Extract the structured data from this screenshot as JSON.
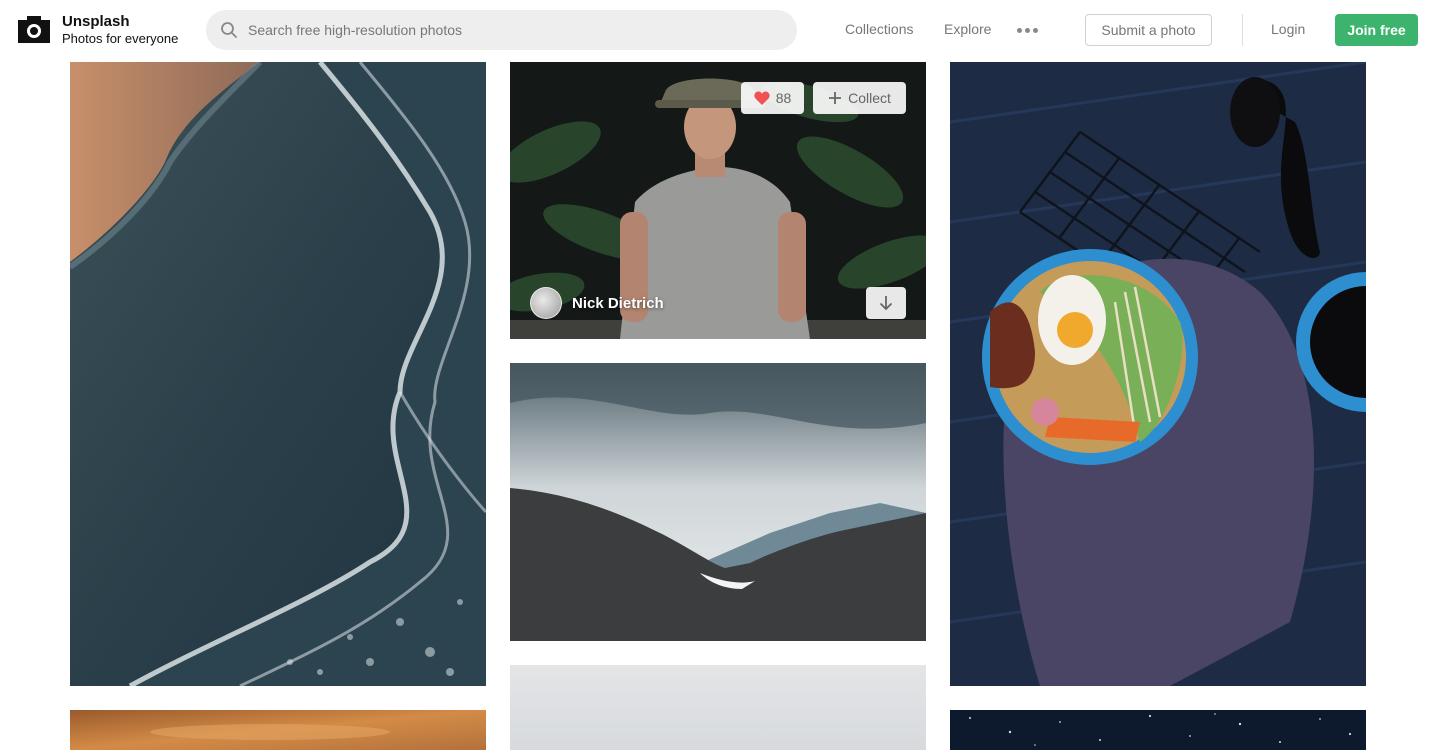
{
  "header": {
    "brand_name": "Unsplash",
    "brand_tagline": "Photos for everyone",
    "search_placeholder": "Search free high-resolution photos",
    "search_value": "",
    "nav": {
      "collections": "Collections",
      "explore": "Explore",
      "submit": "Submit a photo",
      "login": "Login",
      "join": "Join free"
    }
  },
  "featured_photo": {
    "likes": "88",
    "collect_label": "Collect",
    "author": "Nick Dietrich"
  },
  "colors": {
    "accent_green": "#3cb46e",
    "like_heart": "#f15151"
  },
  "icons": [
    "camera-logo-icon",
    "search-icon",
    "more-icon",
    "heart-icon",
    "plus-icon",
    "download-icon"
  ]
}
